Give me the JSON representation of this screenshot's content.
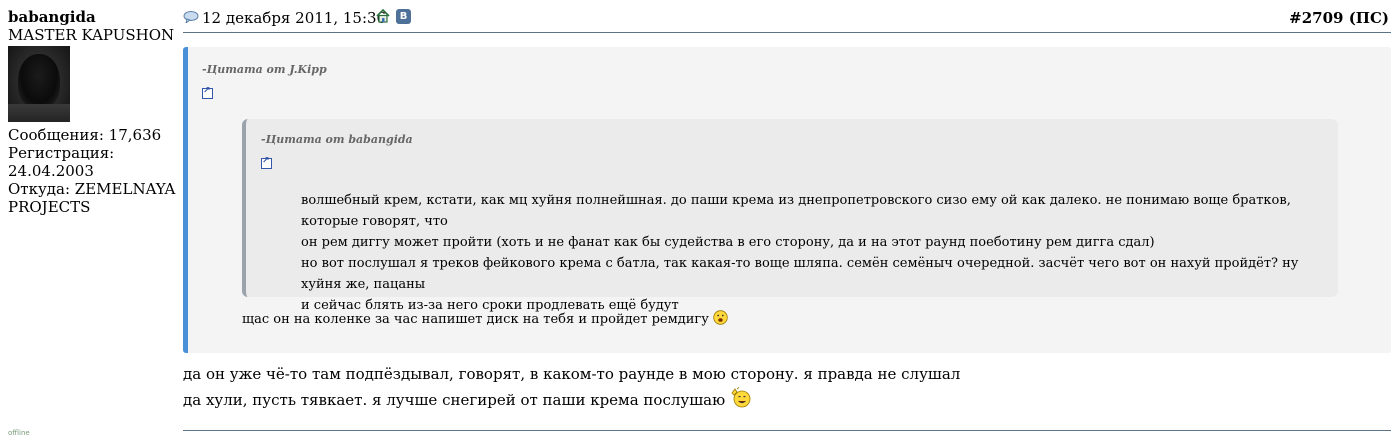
{
  "user": {
    "name": "babangida",
    "title": "MASTER KAPUSHON",
    "posts": "Сообщения: 17,636",
    "registered": "Регистрация: 24.04.2003",
    "location_line1": "Откуда: ZEMELNAYA",
    "location_line2": "PROJECTS",
    "status": "offline"
  },
  "post": {
    "date": "12 декабря 2011, 15:36",
    "number": "#2709",
    "ps_label": "(ПС)",
    "vk_label": "В",
    "icons": [
      "speech-bubble-icon",
      "home-icon",
      "vk-icon",
      "quote-link-icon",
      "smiley-icon"
    ],
    "body_line1": "да он уже чё-то там подпёздывал, говорят, в каком-то раунде в мою сторону. я правда не слушал",
    "body_line2": "да хули, пусть тявкает. я лучше снегирей от паши крема послушаю"
  },
  "quote_outer": {
    "author": "-Цитата от J.Kipp",
    "reply_text": "щас он на коленке за час напишет диск на тебя и пройдет ремдигу"
  },
  "quote_inner": {
    "author": "-Цитата от babangida",
    "line1": "волшебный крем, кстати, как мц хуйня полнейшная. до паши крема из днепропетровского сизо ему ой как далеко. не понимаю воще братков, которые говорят, что",
    "line2": "он рем диггу может пройти (хоть и не фанат как бы судейства в его сторону, да и на этот раунд поеботину рем дигга сдал)",
    "line3": "но вот послушал я треков фейкового крема с батла, так какая-то воще шляпа. семён семёныч очередной. засчёт чего вот он нахуй пройдёт? ну хуйня же, пацаны",
    "line4": "и сейчас блять из-за него сроки продлевать ещё будут"
  },
  "colors": {
    "outer_quote_border": "#4a90d9",
    "outer_quote_bg": "#f4f4f4",
    "inner_quote_bg": "#ebebeb",
    "header_line": "#5d7487"
  }
}
